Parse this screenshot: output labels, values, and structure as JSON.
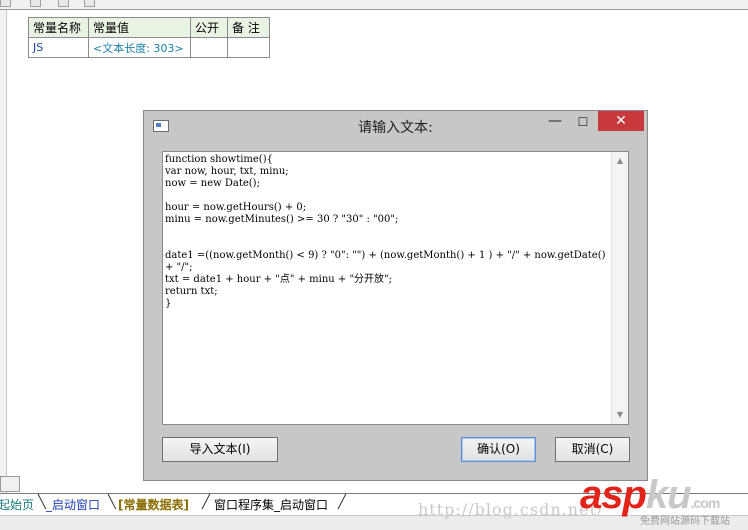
{
  "table": {
    "headers": {
      "name": "常量名称",
      "value": "常量值",
      "public": "公开",
      "note": "备 注"
    },
    "rows": [
      {
        "name": "JS",
        "value": "<文本长度: 303>",
        "public": "",
        "note": ""
      }
    ]
  },
  "dialog": {
    "title": "请输入文本:",
    "minimize_glyph": "—",
    "maximize_glyph": "☐",
    "close_glyph": "✕",
    "code": "function showtime(){\nvar now, hour, txt, minu;\nnow = new Date();\n\nhour = now.getHours() + 0;\nminu = now.getMinutes() >= 30 ? \"30\" : \"00\";\n\n\ndate1 =((now.getMonth() < 9) ? \"0\": \"\") + (now.getMonth() + 1 ) + \"/\" + now.getDate() + \"/\";\ntxt = date1 + hour + \"点\" + minu + \"分开放\";\nreturn txt;\n}",
    "buttons": {
      "import": "导入文本(I)",
      "ok": "确认(O)",
      "cancel": "取消(C)"
    }
  },
  "tabs": {
    "start_page": "起始页",
    "start_window": "_启动窗口",
    "constants": "[常量数据表]",
    "program_set": "窗口程序集_启动窗口"
  },
  "watermark": {
    "url": "http://blog.csdn.net/",
    "logo_main": "asp",
    "logo_ku": "ku",
    "logo_suffix": ".com",
    "subtitle": "免费网站源码下载站"
  },
  "colors": {
    "close_button": "#c7393c",
    "accent_link": "#1f3fb0",
    "constants_tab": "#8a6d00"
  }
}
